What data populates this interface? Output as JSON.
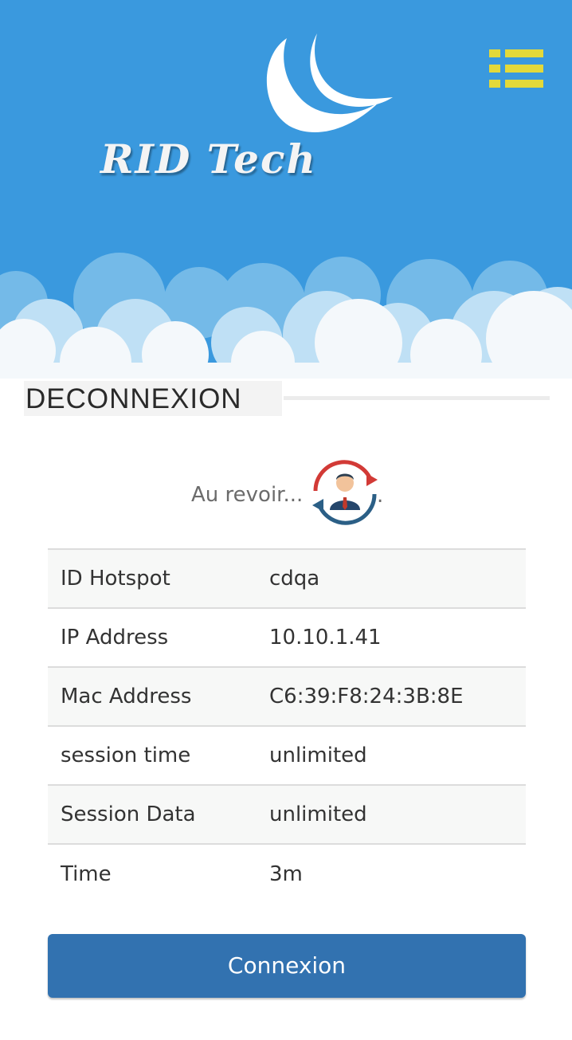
{
  "header": {
    "logo_text": "RID Tech",
    "menu_icon": "list-menu-icon"
  },
  "section": {
    "title": "DECONNEXION"
  },
  "goodbye": {
    "text": "Au revoir...",
    "icon": "user-sync-icon",
    "suffix": "."
  },
  "info_table": {
    "rows": [
      {
        "label": "ID Hotspot",
        "value": "cdqa"
      },
      {
        "label": "IP Address",
        "value": "10.10.1.41"
      },
      {
        "label": "Mac Address",
        "value": "C6:39:F8:24:3B:8E"
      },
      {
        "label": "session time",
        "value": "unlimited"
      },
      {
        "label": "Session Data",
        "value": "unlimited"
      },
      {
        "label": "Time",
        "value": "3m"
      }
    ]
  },
  "buttons": {
    "connect_label": "Connexion"
  },
  "colors": {
    "header_bg": "#3a99de",
    "menu_icon": "#e3d93a",
    "button_bg": "#3272b0"
  }
}
